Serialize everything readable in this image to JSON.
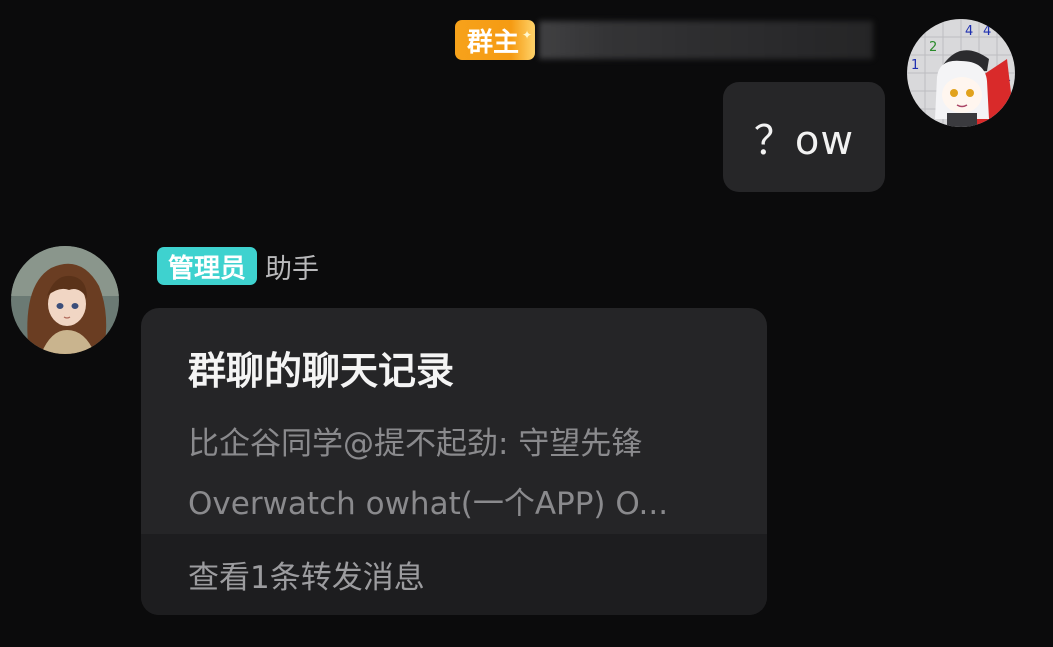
{
  "messages": {
    "outgoing": {
      "badge": "群主",
      "text": "？ow",
      "badge_color": "#f7a21b"
    },
    "incoming": {
      "badge": "管理员",
      "sender_name": "助手",
      "badge_color": "#3ed2cf",
      "forward_card": {
        "title": "群聊的聊天记录",
        "lines": [
          "比企谷同学@提不起劲: 守望先锋",
          "Overwatch owhat(一个APP) O..."
        ],
        "footer": "查看1条转发消息"
      }
    }
  },
  "colors": {
    "background": "#0b0b0c",
    "bubble": "#262628",
    "card": "#252527",
    "card_footer": "#1d1d1f"
  }
}
